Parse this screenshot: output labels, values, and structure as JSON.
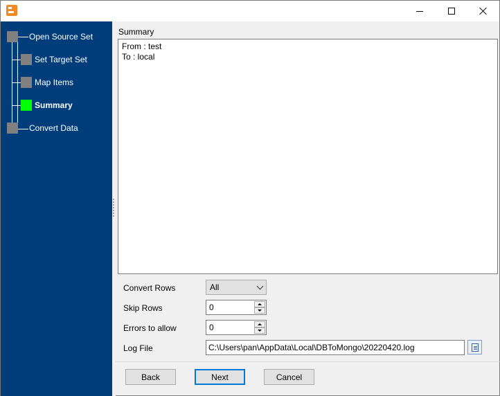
{
  "window": {
    "title": "",
    "controls": {
      "minimize": "minimize",
      "maximize": "maximize",
      "close": "close"
    }
  },
  "wizard": {
    "steps": [
      {
        "label": "Open Source Set",
        "state": "pending"
      },
      {
        "label": "Set Target Set",
        "state": "pending"
      },
      {
        "label": "Map Items",
        "state": "pending"
      },
      {
        "label": "Summary",
        "state": "active"
      },
      {
        "label": "Convert Data",
        "state": "pending"
      }
    ],
    "colors": {
      "sidebar": "#003d7a",
      "active_node": "#00ff00",
      "node": "#808080"
    }
  },
  "summary": {
    "title": "Summary",
    "lines": [
      "From : test",
      "To : local"
    ]
  },
  "form": {
    "convert_rows": {
      "label": "Convert Rows",
      "value": "All"
    },
    "skip_rows": {
      "label": "Skip Rows",
      "value": "0"
    },
    "errors_to_allow": {
      "label": "Errors to allow",
      "value": "0"
    },
    "log_file": {
      "label": "Log File",
      "value": "C:\\Users\\pan\\AppData\\Local\\DBToMongo\\20220420.log"
    }
  },
  "buttons": {
    "back": "Back",
    "next": "Next",
    "cancel": "Cancel"
  }
}
